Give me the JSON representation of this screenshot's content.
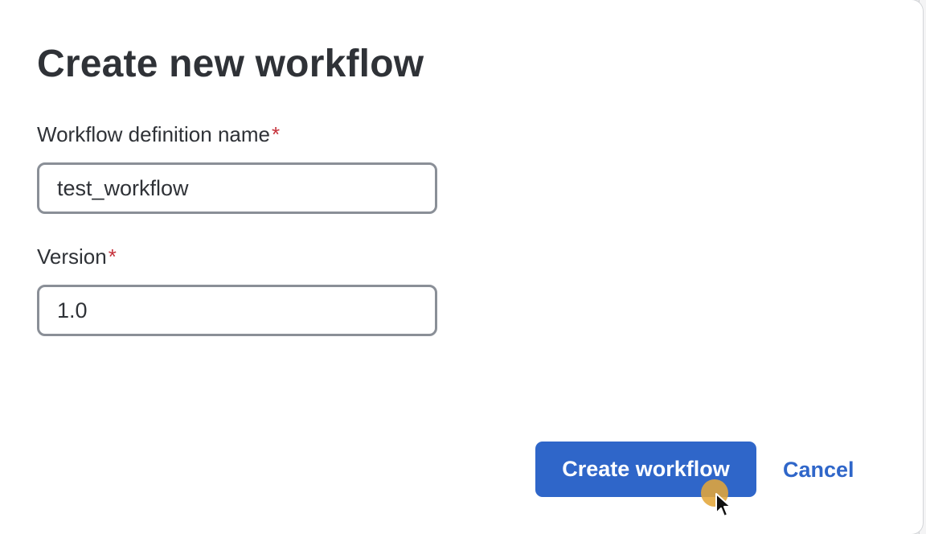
{
  "dialog": {
    "title": "Create new workflow",
    "fields": [
      {
        "label": "Workflow definition name",
        "required_mark": "*",
        "value": "test_workflow",
        "placeholder": ""
      },
      {
        "label": "Version",
        "required_mark": "*",
        "value": "1.0",
        "placeholder": ""
      }
    ],
    "primary_action_label": "Create workflow",
    "secondary_action_label": "Cancel"
  },
  "colors": {
    "accent": "#2f66c9",
    "required": "#c5303a",
    "text": "#2f3237",
    "input_border": "#8a8f97",
    "click_indicator": "#e2a63a"
  },
  "icons": {
    "cursor": "mouse-pointer-icon"
  }
}
